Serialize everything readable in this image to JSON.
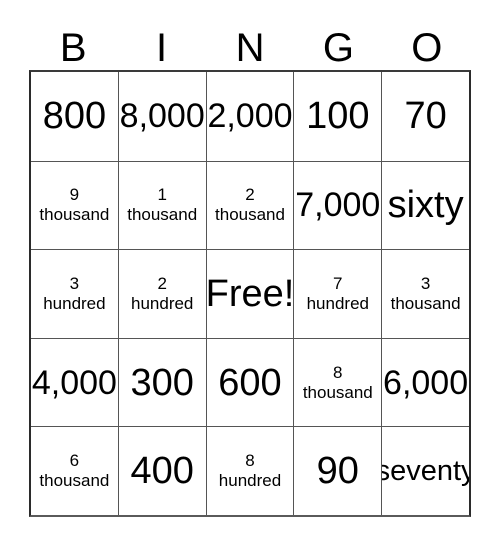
{
  "card": {
    "header": {
      "letters": [
        "B",
        "I",
        "N",
        "G",
        "O"
      ]
    },
    "rows": [
      [
        {
          "text": "800",
          "style": "big"
        },
        {
          "text": "8,000",
          "style": "big-fit"
        },
        {
          "text": "2,000",
          "style": "big-fit"
        },
        {
          "text": "100",
          "style": "big"
        },
        {
          "text": "70",
          "style": "big"
        }
      ],
      [
        {
          "num": "9",
          "word": "thousand",
          "style": "stacked"
        },
        {
          "num": "1",
          "word": "thousand",
          "style": "stacked"
        },
        {
          "num": "2",
          "word": "thousand",
          "style": "stacked"
        },
        {
          "text": "7,000",
          "style": "big-fit"
        },
        {
          "text": "sixty",
          "style": "big"
        }
      ],
      [
        {
          "num": "3",
          "word": "hundred",
          "style": "stacked"
        },
        {
          "num": "2",
          "word": "hundred",
          "style": "stacked"
        },
        {
          "text": "Free!",
          "style": "big",
          "free": true
        },
        {
          "num": "7",
          "word": "hundred",
          "style": "stacked"
        },
        {
          "num": "3",
          "word": "thousand",
          "style": "stacked"
        }
      ],
      [
        {
          "text": "4,000",
          "style": "big-fit"
        },
        {
          "text": "300",
          "style": "big"
        },
        {
          "text": "600",
          "style": "big"
        },
        {
          "num": "8",
          "word": "thousand",
          "style": "stacked"
        },
        {
          "text": "6,000",
          "style": "big-fit"
        }
      ],
      [
        {
          "num": "6",
          "word": "thousand",
          "style": "stacked"
        },
        {
          "text": "400",
          "style": "big"
        },
        {
          "num": "8",
          "word": "hundred",
          "style": "stacked"
        },
        {
          "text": "90",
          "style": "big"
        },
        {
          "text": "seventy",
          "style": "big-fit-sm"
        }
      ]
    ]
  },
  "colors": {
    "background": "#ffffff",
    "text": "#000000",
    "grid_line": "#555555",
    "grid_outer": "#2b2b2b"
  }
}
